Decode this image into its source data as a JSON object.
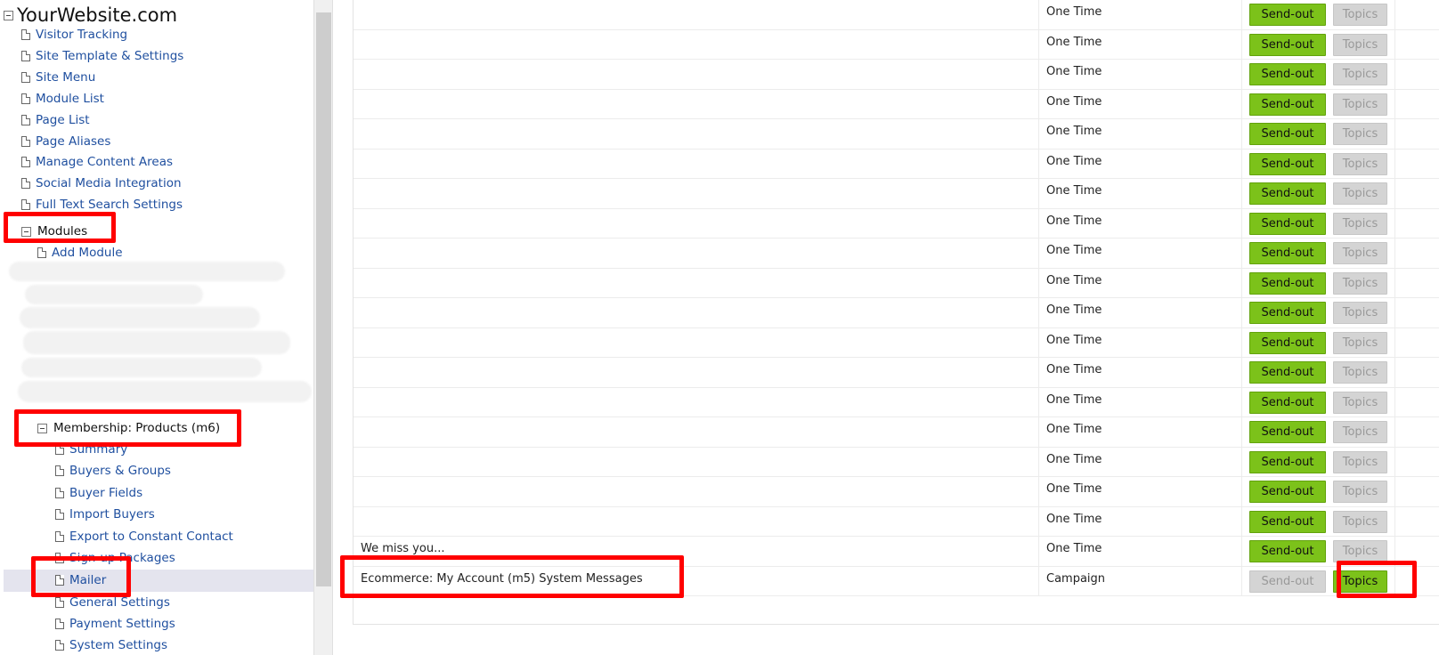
{
  "sidebar": {
    "site_title": "YourWebsite.com",
    "items": [
      {
        "label": "Visitor Tracking"
      },
      {
        "label": "Site Template & Settings"
      },
      {
        "label": "Site Menu"
      },
      {
        "label": "Module List"
      },
      {
        "label": "Page List"
      },
      {
        "label": "Page Aliases"
      },
      {
        "label": "Manage Content Areas"
      },
      {
        "label": "Social Media Integration"
      },
      {
        "label": "Full Text Search Settings"
      }
    ],
    "modules_label": "Modules",
    "add_module_label": "Add Module",
    "membership_label": "Membership: Products (m6)",
    "membership_items": [
      {
        "label": "Summary"
      },
      {
        "label": "Buyers & Groups"
      },
      {
        "label": "Buyer Fields"
      },
      {
        "label": "Import Buyers"
      },
      {
        "label": "Export to Constant Contact"
      },
      {
        "label": "Sign-up Packages"
      },
      {
        "label": "Mailer"
      },
      {
        "label": "General Settings"
      },
      {
        "label": "Payment Settings"
      },
      {
        "label": "System Settings"
      }
    ]
  },
  "table": {
    "rows": [
      {
        "name": "",
        "type": "One Time",
        "send_label": "Send-out",
        "topics_label": "Topics",
        "send_enabled": true,
        "topics_enabled": false
      },
      {
        "name": "",
        "type": "One Time",
        "send_label": "Send-out",
        "topics_label": "Topics",
        "send_enabled": true,
        "topics_enabled": false
      },
      {
        "name": "",
        "type": "One Time",
        "send_label": "Send-out",
        "topics_label": "Topics",
        "send_enabled": true,
        "topics_enabled": false
      },
      {
        "name": "",
        "type": "One Time",
        "send_label": "Send-out",
        "topics_label": "Topics",
        "send_enabled": true,
        "topics_enabled": false
      },
      {
        "name": "",
        "type": "One Time",
        "send_label": "Send-out",
        "topics_label": "Topics",
        "send_enabled": true,
        "topics_enabled": false
      },
      {
        "name": "",
        "type": "One Time",
        "send_label": "Send-out",
        "topics_label": "Topics",
        "send_enabled": true,
        "topics_enabled": false
      },
      {
        "name": "",
        "type": "One Time",
        "send_label": "Send-out",
        "topics_label": "Topics",
        "send_enabled": true,
        "topics_enabled": false
      },
      {
        "name": "",
        "type": "One Time",
        "send_label": "Send-out",
        "topics_label": "Topics",
        "send_enabled": true,
        "topics_enabled": false
      },
      {
        "name": "",
        "type": "One Time",
        "send_label": "Send-out",
        "topics_label": "Topics",
        "send_enabled": true,
        "topics_enabled": false
      },
      {
        "name": "",
        "type": "One Time",
        "send_label": "Send-out",
        "topics_label": "Topics",
        "send_enabled": true,
        "topics_enabled": false
      },
      {
        "name": "",
        "type": "One Time",
        "send_label": "Send-out",
        "topics_label": "Topics",
        "send_enabled": true,
        "topics_enabled": false
      },
      {
        "name": "",
        "type": "One Time",
        "send_label": "Send-out",
        "topics_label": "Topics",
        "send_enabled": true,
        "topics_enabled": false
      },
      {
        "name": "",
        "type": "One Time",
        "send_label": "Send-out",
        "topics_label": "Topics",
        "send_enabled": true,
        "topics_enabled": false
      },
      {
        "name": "",
        "type": "One Time",
        "send_label": "Send-out",
        "topics_label": "Topics",
        "send_enabled": true,
        "topics_enabled": false
      },
      {
        "name": "",
        "type": "One Time",
        "send_label": "Send-out",
        "topics_label": "Topics",
        "send_enabled": true,
        "topics_enabled": false
      },
      {
        "name": "",
        "type": "One Time",
        "send_label": "Send-out",
        "topics_label": "Topics",
        "send_enabled": true,
        "topics_enabled": false
      },
      {
        "name": "",
        "type": "One Time",
        "send_label": "Send-out",
        "topics_label": "Topics",
        "send_enabled": true,
        "topics_enabled": false
      },
      {
        "name": "",
        "type": "One Time",
        "send_label": "Send-out",
        "topics_label": "Topics",
        "send_enabled": true,
        "topics_enabled": false
      },
      {
        "name": "We miss you...",
        "type": "One Time",
        "send_label": "Send-out",
        "topics_label": "Topics",
        "send_enabled": true,
        "topics_enabled": false
      },
      {
        "name": "Ecommerce: My Account (m5) System Messages",
        "type": "Campaign",
        "send_label": "Send-out",
        "topics_label": "Topics",
        "send_enabled": false,
        "topics_enabled": true
      }
    ]
  },
  "colors": {
    "accent_green": "#7cc21a",
    "disabled_gray": "#d4d4d4",
    "link_blue": "#1f4f9f",
    "highlight_red": "#ff0000"
  }
}
